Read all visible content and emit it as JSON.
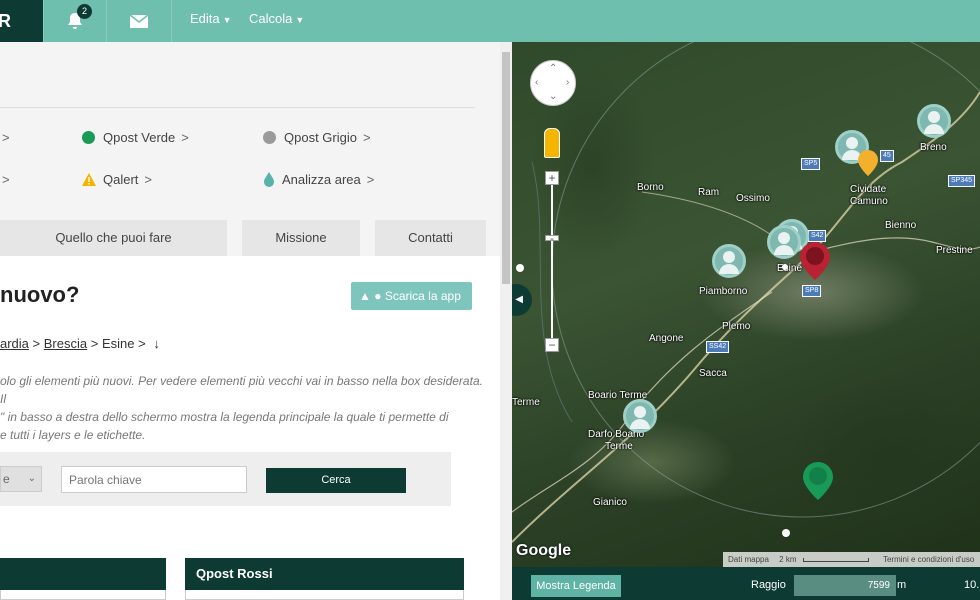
{
  "nav": {
    "logo": "R",
    "notifications_count": "2",
    "menu_edita": "Edita",
    "menu_calcola": "Calcola"
  },
  "features": {
    "verde": "Qpost Verde",
    "grigio": "Qpost Grigio",
    "qalert": "Qalert",
    "analizza": "Analizza area"
  },
  "tabs": {
    "quello": "Quello che puoi fare",
    "missione": "Missione",
    "contatti": "Contatti"
  },
  "main": {
    "title": "nuovo?",
    "app_button": "Scarica la app",
    "breadcrumb": {
      "part1": "ardia",
      "part2": "Brescia",
      "part3": "Esine >"
    },
    "desc_line1": "olo gli elementi più nuovi. Per vedere elementi più vecchi vai in basso nella box desiderata. Il",
    "desc_line2": "\" in basso a destra dello schermo mostra la legenda principale la quale ti permette di",
    "desc_line3": "e tutti i layers e le etichette.",
    "select_value": "e",
    "keyword_placeholder": "Parola chiave",
    "search_button": "Cerca",
    "box_rossi": "Qpost Rossi"
  },
  "map": {
    "places": {
      "breno": "Breno",
      "cividate": "Cividate",
      "camuno": "Camuno",
      "borno": "Borno",
      "ram": "Ram",
      "ossimo": "Ossimo",
      "bienno": "Bienno",
      "prestine": "Prestine",
      "esine": "Esine",
      "piamborno": "Piamborno",
      "plemo": "Plemo",
      "angone": "Angone",
      "sacca": "Sacca",
      "boario": "Boario Terme",
      "darfo": "Darfo Boario",
      "terme": "Terme",
      "terme2": "Terme",
      "gianico": "Gianico"
    },
    "roads": {
      "sp5": "SP5",
      "sp42": "S42",
      "sp8": "SP8",
      "ss42": "SS42",
      "sp345": "SP345",
      "n45": "45"
    },
    "attribution": {
      "dati": "Dati mappa",
      "scale": "2 km",
      "terms": "Termini e condizioni d'uso"
    },
    "google": "Google"
  },
  "bottombar": {
    "legend_button": "Mostra Legenda",
    "raggio_label": "Raggio",
    "raggio_value": "7599",
    "unit": "m",
    "right_value": "10."
  },
  "colors": {
    "dark": "#0e3a34",
    "teal": "#6fbfae",
    "verde": "#1a9a57",
    "grigio": "#9a9a9a",
    "marker_red": "#b82232",
    "marker_green": "#1a9a57"
  }
}
